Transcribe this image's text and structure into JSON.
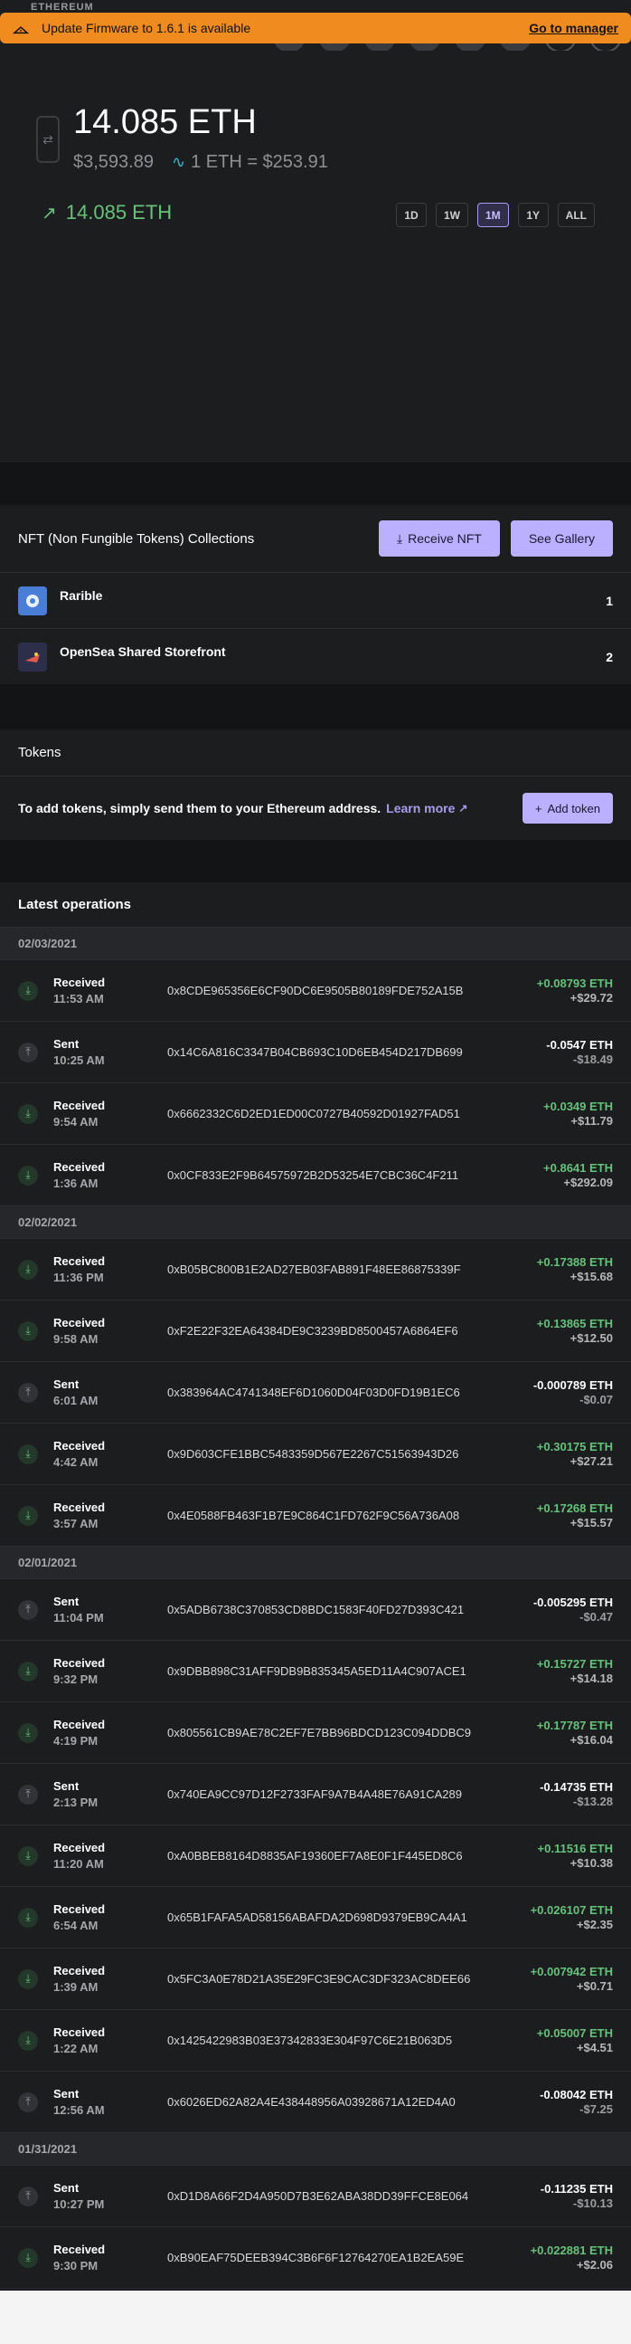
{
  "header": {
    "section_label": "ETHEREUM"
  },
  "banner": {
    "message": "Update Firmware to 1.6.1 is available",
    "link": "Go to manager"
  },
  "account": {
    "balance": "14.085 ETH",
    "fiat_balance": "$3,593.89",
    "rate": "1 ETH = $253.91",
    "delta": "14.085 ETH"
  },
  "ranges": [
    "1D",
    "1W",
    "1M",
    "1Y",
    "ALL"
  ],
  "nft": {
    "title": "NFT (Non Fungible Tokens) Collections",
    "receive_label": "Receive NFT",
    "gallery_label": "See Gallery",
    "collections": [
      {
        "name": "Rarible",
        "count": "1"
      },
      {
        "name": "OpenSea Shared Storefront",
        "count": "2"
      }
    ]
  },
  "tokens": {
    "title": "Tokens",
    "message": "To add tokens, simply send them to your Ethereum address.",
    "learn_more": "Learn more",
    "add_label": "Add token"
  },
  "operations": {
    "title": "Latest operations",
    "groups": [
      {
        "date": "02/03/2021",
        "items": [
          {
            "type": "Received",
            "time": "11:53 AM",
            "hash": "0x8CDE965356E6CF90DC6E9505B80189FDE752A15B",
            "amount": "+0.08793 ETH",
            "fiat": "+$29.72"
          },
          {
            "type": "Sent",
            "time": "10:25 AM",
            "hash": "0x14C6A816C3347B04CB693C10D6EB454D217DB699",
            "amount": "-0.0547 ETH",
            "fiat": "-$18.49"
          },
          {
            "type": "Received",
            "time": "9:54 AM",
            "hash": "0x6662332C6D2ED1ED00C0727B40592D01927FAD51",
            "amount": "+0.0349 ETH",
            "fiat": "+$11.79"
          },
          {
            "type": "Received",
            "time": "1:36 AM",
            "hash": "0x0CF833E2F9B64575972B2D53254E7CBC36C4F211",
            "amount": "+0.8641 ETH",
            "fiat": "+$292.09"
          }
        ]
      },
      {
        "date": "02/02/2021",
        "items": [
          {
            "type": "Received",
            "time": "11:36 PM",
            "hash": "0xB05BC800B1E2AD27EB03FAB891F48EE86875339F",
            "amount": "+0.17388 ETH",
            "fiat": "+$15.68"
          },
          {
            "type": "Received",
            "time": "9:58 AM",
            "hash": "0xF2E22F32EA64384DE9C3239BD8500457A6864EF6",
            "amount": "+0.13865 ETH",
            "fiat": "+$12.50"
          },
          {
            "type": "Sent",
            "time": "6:01 AM",
            "hash": "0x383964AC4741348EF6D1060D04F03D0FD19B1EC6",
            "amount": "-0.000789 ETH",
            "fiat": "-$0.07"
          },
          {
            "type": "Received",
            "time": "4:42 AM",
            "hash": "0x9D603CFE1BBC5483359D567E2267C51563943D26",
            "amount": "+0.30175 ETH",
            "fiat": "+$27.21"
          },
          {
            "type": "Received",
            "time": "3:57 AM",
            "hash": "0x4E0588FB463F1B7E9C864C1FD762F9C56A736A08",
            "amount": "+0.17268 ETH",
            "fiat": "+$15.57"
          }
        ]
      },
      {
        "date": "02/01/2021",
        "items": [
          {
            "type": "Sent",
            "time": "11:04 PM",
            "hash": "0x5ADB6738C370853CD8BDC1583F40FD27D393C421",
            "amount": "-0.005295 ETH",
            "fiat": "-$0.47"
          },
          {
            "type": "Received",
            "time": "9:32 PM",
            "hash": "0x9DBB898C31AFF9DB9B835345A5ED11A4C907ACE1",
            "amount": "+0.15727 ETH",
            "fiat": "+$14.18"
          },
          {
            "type": "Received",
            "time": "4:19 PM",
            "hash": "0x805561CB9AE78C2EF7E7BB96BDCD123C094DDBC9",
            "amount": "+0.17787 ETH",
            "fiat": "+$16.04"
          },
          {
            "type": "Sent",
            "time": "2:13 PM",
            "hash": "0x740EA9CC97D12F2733FAF9A7B4A48E76A91CA289",
            "amount": "-0.14735 ETH",
            "fiat": "-$13.28"
          },
          {
            "type": "Received",
            "time": "11:20 AM",
            "hash": "0xA0BBEB8164D8835AF19360EF7A8E0F1F445ED8C6",
            "amount": "+0.11516 ETH",
            "fiat": "+$10.38"
          },
          {
            "type": "Received",
            "time": "6:54 AM",
            "hash": "0x65B1FAFA5AD58156ABAFDA2D698D9379EB9CA4A1",
            "amount": "+0.026107 ETH",
            "fiat": "+$2.35"
          },
          {
            "type": "Received",
            "time": "1:39 AM",
            "hash": "0x5FC3A0E78D21A35E29FC3E9CAC3DF323AC8DEE66",
            "amount": "+0.007942 ETH",
            "fiat": "+$0.71"
          },
          {
            "type": "Received",
            "time": "1:22 AM",
            "hash": "0x1425422983B03E37342833E304F97C6E21B063D5",
            "amount": "+0.05007 ETH",
            "fiat": "+$4.51"
          },
          {
            "type": "Sent",
            "time": "12:56 AM",
            "hash": "0x6026ED62A82A4E438448956A03928671A12ED4A0",
            "amount": "-0.08042 ETH",
            "fiat": "-$7.25"
          }
        ]
      },
      {
        "date": "01/31/2021",
        "items": [
          {
            "type": "Sent",
            "time": "10:27 PM",
            "hash": "0xD1D8A66F2D4A950D7B3E62ABA38DD39FFCE8E064",
            "amount": "-0.11235 ETH",
            "fiat": "-$10.13"
          },
          {
            "type": "Received",
            "time": "9:30 PM",
            "hash": "0xB90EAF75DEEB394C3B6F6F12764270EA1B2EA59E",
            "amount": "+0.022881 ETH",
            "fiat": "+$2.06"
          }
        ]
      }
    ]
  }
}
